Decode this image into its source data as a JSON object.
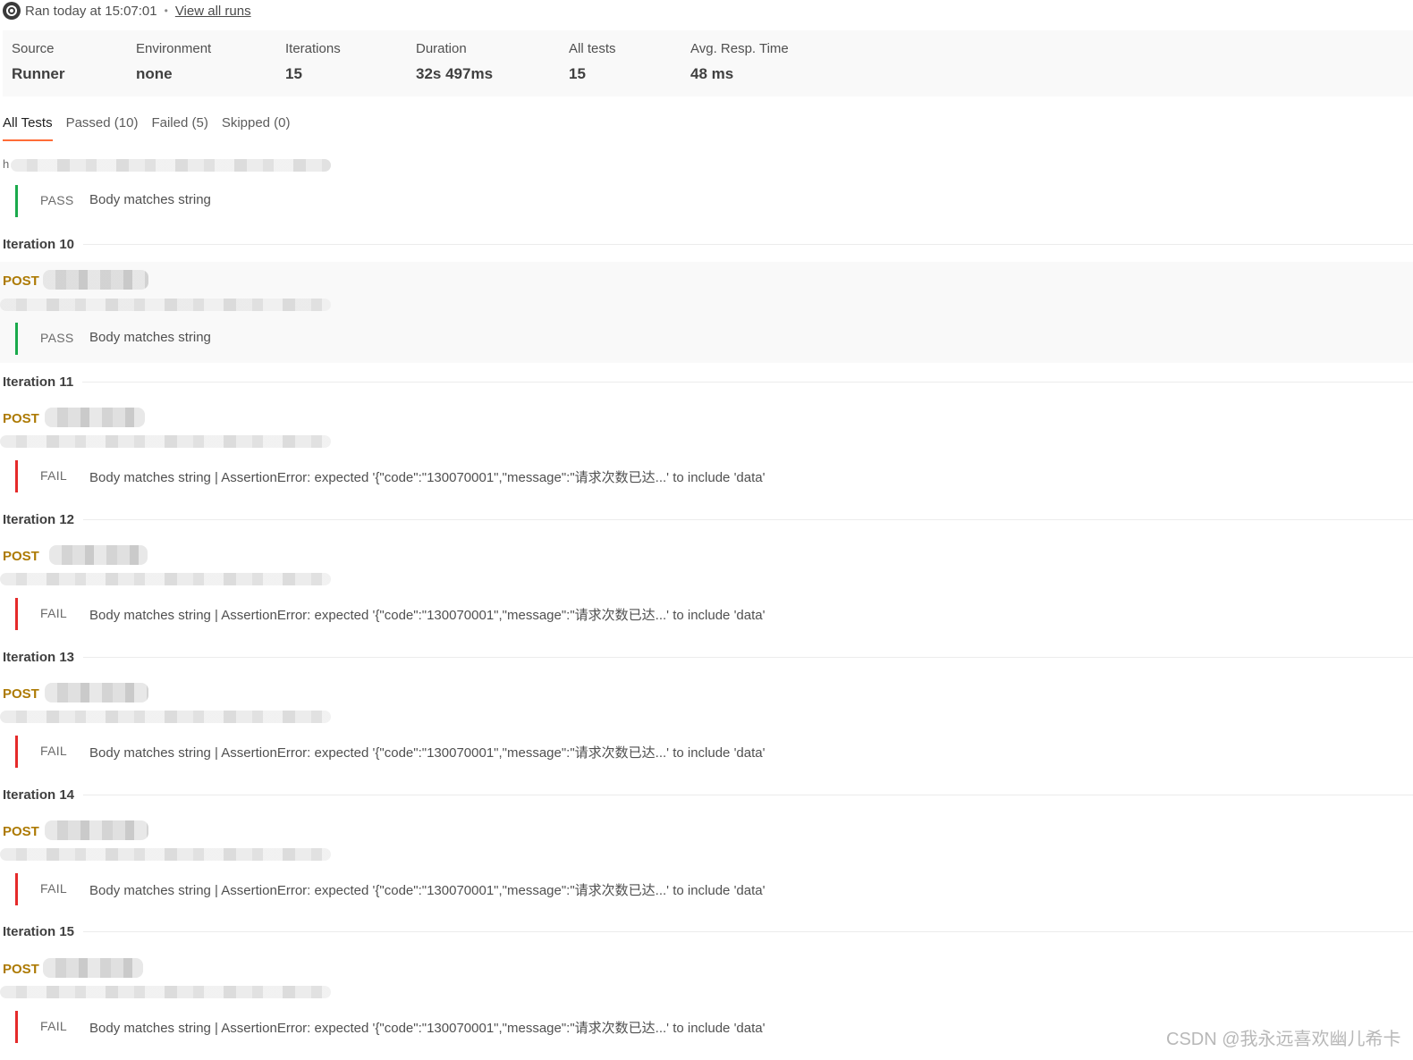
{
  "header": {
    "ran_text": "Ran today at 15:07:01",
    "separator": "•",
    "view_all_runs": "View all runs",
    "icon": "run-status-icon"
  },
  "summary": {
    "source_label": "Source",
    "source_value": "Runner",
    "environment_label": "Environment",
    "environment_value": "none",
    "iterations_label": "Iterations",
    "iterations_value": "15",
    "duration_label": "Duration",
    "duration_value": "32s 497ms",
    "all_tests_label": "All tests",
    "all_tests_value": "15",
    "avg_resp_label": "Avg. Resp. Time",
    "avg_resp_value": "48 ms"
  },
  "tabs": {
    "all": "All Tests",
    "passed": "Passed (10)",
    "failed": "Failed (5)",
    "skipped": "Skipped (0)"
  },
  "colors": {
    "pass": "#1aaa4c",
    "fail": "#e52a2a",
    "method_post": "#ad7a03",
    "tab_active_underline": "#ff6c37"
  },
  "first_result": {
    "url_stub": "h",
    "status": "PASS",
    "text": "Body matches string"
  },
  "iterations": [
    {
      "title": "Iteration 10",
      "method": "POST",
      "status": "PASS",
      "text": "Body matches string"
    },
    {
      "title": "Iteration 11",
      "method": "POST",
      "status": "FAIL",
      "text": "Body matches string | AssertionError: expected '{\"code\":\"130070001\",\"message\":\"请求次数已达...' to include 'data'"
    },
    {
      "title": "Iteration 12",
      "method": "POST",
      "status": "FAIL",
      "text": "Body matches string | AssertionError: expected '{\"code\":\"130070001\",\"message\":\"请求次数已达...' to include 'data'"
    },
    {
      "title": "Iteration 13",
      "method": "POST",
      "status": "FAIL",
      "text": "Body matches string | AssertionError: expected '{\"code\":\"130070001\",\"message\":\"请求次数已达...' to include 'data'"
    },
    {
      "title": "Iteration 14",
      "method": "POST",
      "status": "FAIL",
      "text": "Body matches string | AssertionError: expected '{\"code\":\"130070001\",\"message\":\"请求次数已达...' to include 'data'"
    },
    {
      "title": "Iteration 15",
      "method": "POST",
      "status": "FAIL",
      "text": "Body matches string | AssertionError: expected '{\"code\":\"130070001\",\"message\":\"请求次数已达...' to include 'data'"
    }
  ],
  "watermark": "CSDN @我永远喜欢幽儿希卡"
}
